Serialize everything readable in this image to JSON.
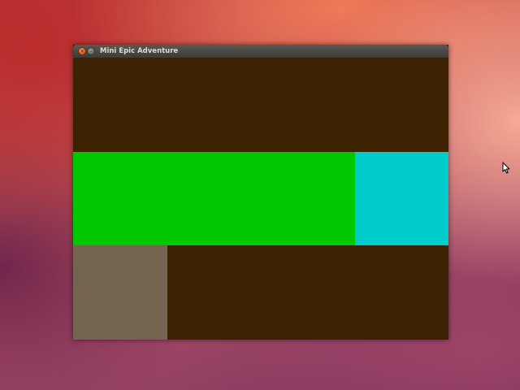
{
  "window": {
    "title": "Mini Epic Adventure",
    "close_glyph": "×",
    "minimize_glyph": "–"
  },
  "game": {
    "grid": {
      "cols": 4,
      "rows": 3
    },
    "colors": {
      "floor": "#3c2200",
      "grass": "#00c800",
      "water": "#00cccc",
      "stone": "#756450"
    },
    "tiles": [
      {
        "name": "floor-row-1",
        "kind": "floor",
        "col": 0,
        "row": 0,
        "cols": 4,
        "rows": 1
      },
      {
        "name": "grass-block",
        "kind": "grass",
        "col": 0,
        "row": 1,
        "cols": 3,
        "rows": 1
      },
      {
        "name": "water-block",
        "kind": "water",
        "col": 3,
        "row": 1,
        "cols": 1,
        "rows": 1
      },
      {
        "name": "stone-block",
        "kind": "stone",
        "col": 0,
        "row": 2,
        "cols": 1,
        "rows": 1
      },
      {
        "name": "floor-row-3",
        "kind": "floor",
        "col": 1,
        "row": 2,
        "cols": 3,
        "rows": 1
      }
    ]
  }
}
